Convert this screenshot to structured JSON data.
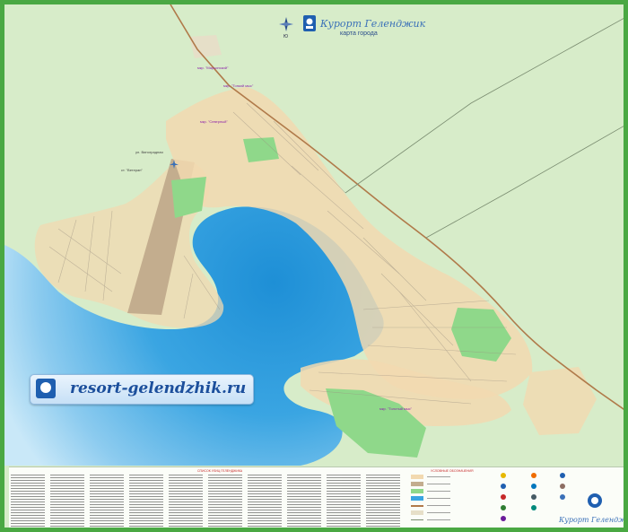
{
  "map": {
    "title": "Курорт Геленджик",
    "subtitle": "карта города",
    "compass_label": "Ю",
    "banner_text": "resort-gelendzhik.ru",
    "corner_title": "Курорт Геленджик",
    "colors": {
      "land": "#d7ecc9",
      "sea_deep": "#1e8fd6",
      "sea_shallow": "#bfe3f7",
      "urban": "#f2d9b0",
      "airport": "#c3ad8e",
      "park": "#8fd88a",
      "frame": "#4aa843",
      "road": "#b07a4a"
    },
    "legend": {
      "streets_title": "СПИСОК УЛИЦ ГЕЛЕНДЖИКА",
      "symbols_title": "УСЛОВНЫЕ ОБОЗНАЧЕНИЯ"
    },
    "place_labels": [
      "мкр. \"Марьинский\"",
      "мкр. \"Тонкий мыс\"",
      "мкр. \"Северный\"",
      "ул. Виноградная",
      "ст. \"Ветеран\"",
      "мкр. \"Толстый мыс\""
    ]
  }
}
